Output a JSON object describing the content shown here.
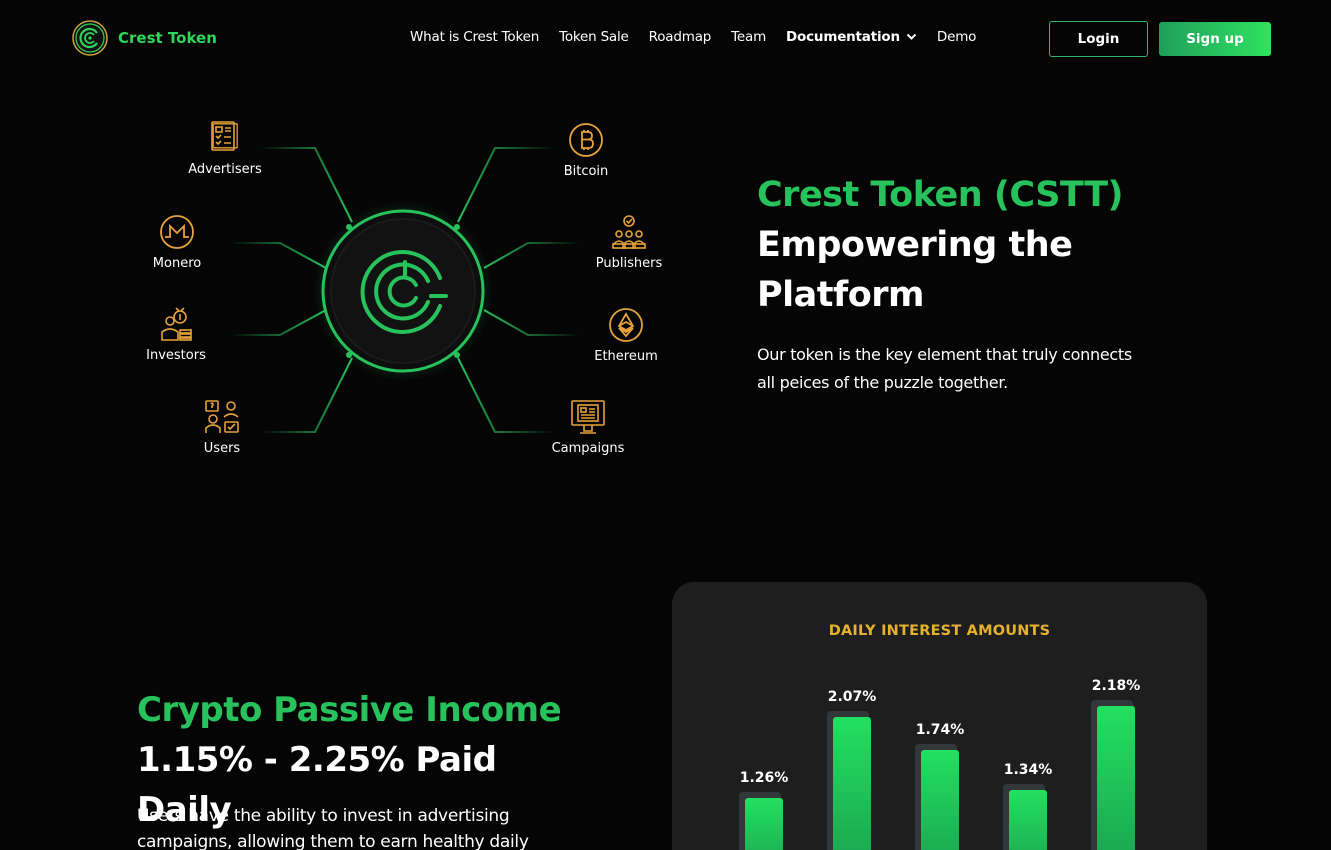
{
  "brand": {
    "name": "Crest Token",
    "accent": "#27c25c",
    "gold": "#e6b22b"
  },
  "nav": {
    "links": [
      "What is Crest Token",
      "Token Sale",
      "Roadmap",
      "Team"
    ],
    "documentation": "Documentation",
    "demo": "Demo",
    "login": "Login",
    "signup": "Sign up"
  },
  "diagram": {
    "left": [
      {
        "label": "Advertisers",
        "icon": "advertisers-icon"
      },
      {
        "label": "Monero",
        "icon": "monero-icon"
      },
      {
        "label": "Investors",
        "icon": "investors-icon"
      },
      {
        "label": "Users",
        "icon": "users-icon"
      }
    ],
    "right": [
      {
        "label": "Bitcoin",
        "icon": "bitcoin-icon"
      },
      {
        "label": "Publishers",
        "icon": "publishers-icon"
      },
      {
        "label": "Ethereum",
        "icon": "ethereum-icon"
      },
      {
        "label": "Campaigns",
        "icon": "campaigns-icon"
      }
    ],
    "center_icon": "crest-token-logo-icon"
  },
  "hero": {
    "title_green": "Crest Token (CSTT)",
    "title_white": "Empowering the Platform",
    "description": "Our token is the key element that truly connects all peices of the puzzle together."
  },
  "income": {
    "title_green": "Crypto Passive Income",
    "title_white": "1.15% - 2.25% Paid Daily",
    "description": "Users have the ability to invest in advertising campaigns, allowing them to earn healthy daily"
  },
  "chart_data": {
    "type": "bar",
    "title": "DAILY INTEREST AMOUNTS",
    "categories": [
      "",
      "",
      "",
      "",
      ""
    ],
    "values": [
      1.26,
      2.07,
      1.74,
      1.34,
      2.18
    ],
    "labels": [
      "1.26%",
      "2.07%",
      "1.74%",
      "1.34%",
      "2.18%"
    ],
    "unit": "%",
    "bar_color": "#22e060",
    "grid": false
  }
}
